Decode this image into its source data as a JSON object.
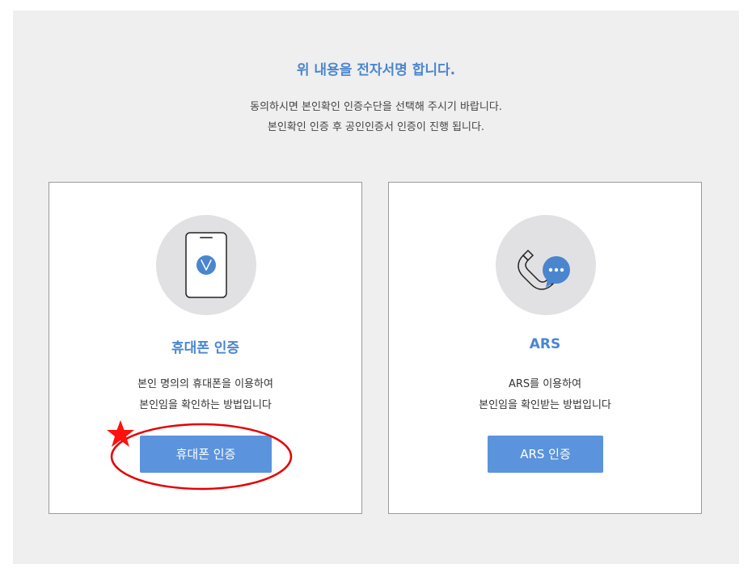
{
  "page": {
    "heading": "위 내용을 전자서명 합니다.",
    "description_line1": "동의하시면 본인확인 인증수단을 선택해 주시기 바랍니다.",
    "description_line2": "본인확인 인증 후 공인인증서 인증이 진행 됩니다."
  },
  "cards": {
    "phone": {
      "icon": "smartphone-check-icon",
      "title": "휴대폰 인증",
      "desc_line1": "본인 명의의 휴대폰을 이용하여",
      "desc_line2": "본인임을 확인하는 방법입니다",
      "button_label": "휴대폰 인증"
    },
    "ars": {
      "icon": "phone-chat-icon",
      "title": "ARS",
      "desc_line1": "ARS를 이용하여",
      "desc_line2": "본인임을 확인받는 방법입니다",
      "button_label": "ARS 인증"
    }
  },
  "colors": {
    "accent": "#4a86cf",
    "button": "#5b93dc",
    "panel_bg": "#efefef",
    "highlight": "#e60000"
  }
}
